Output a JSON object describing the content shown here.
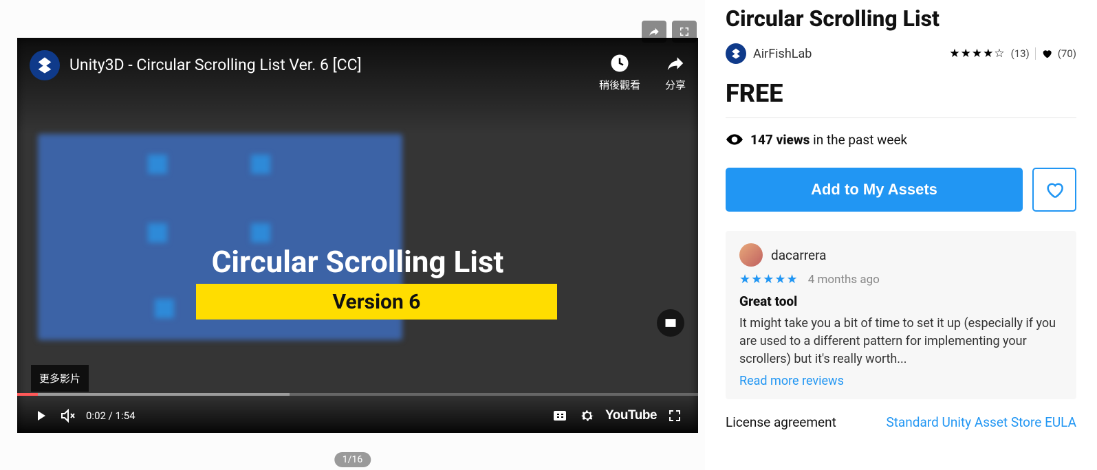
{
  "media": {
    "share_icon": "share",
    "expand_icon": "expand",
    "pager": "1/16"
  },
  "video": {
    "title": "Unity3D - Circular Scrolling List Ver. 6 [CC]",
    "watch_later": "稍後觀看",
    "share": "分享",
    "overlay_title": "Circular Scrolling List",
    "version_band": "Version 6",
    "more_tag": "更多影片",
    "current_time": "0:02",
    "duration": "1:54",
    "youtube_label": "YouTube"
  },
  "asset": {
    "title": "Circular Scrolling List",
    "publisher": "AirFishLab",
    "rating_count": "(13)",
    "favorites": "(70)",
    "price": "FREE",
    "views_count": "147 views",
    "views_suffix": "in the past week",
    "add_label": "Add to My Assets"
  },
  "review": {
    "user": "dacarrera",
    "date": "4 months ago",
    "title": "Great tool",
    "body": "It might take you a bit of time to set it up (especially if you are used to a different pattern for implementing your scrollers) but it's really worth...",
    "more_link": "Read more reviews"
  },
  "license": {
    "label": "License agreement",
    "value": "Standard Unity Asset Store EULA"
  }
}
